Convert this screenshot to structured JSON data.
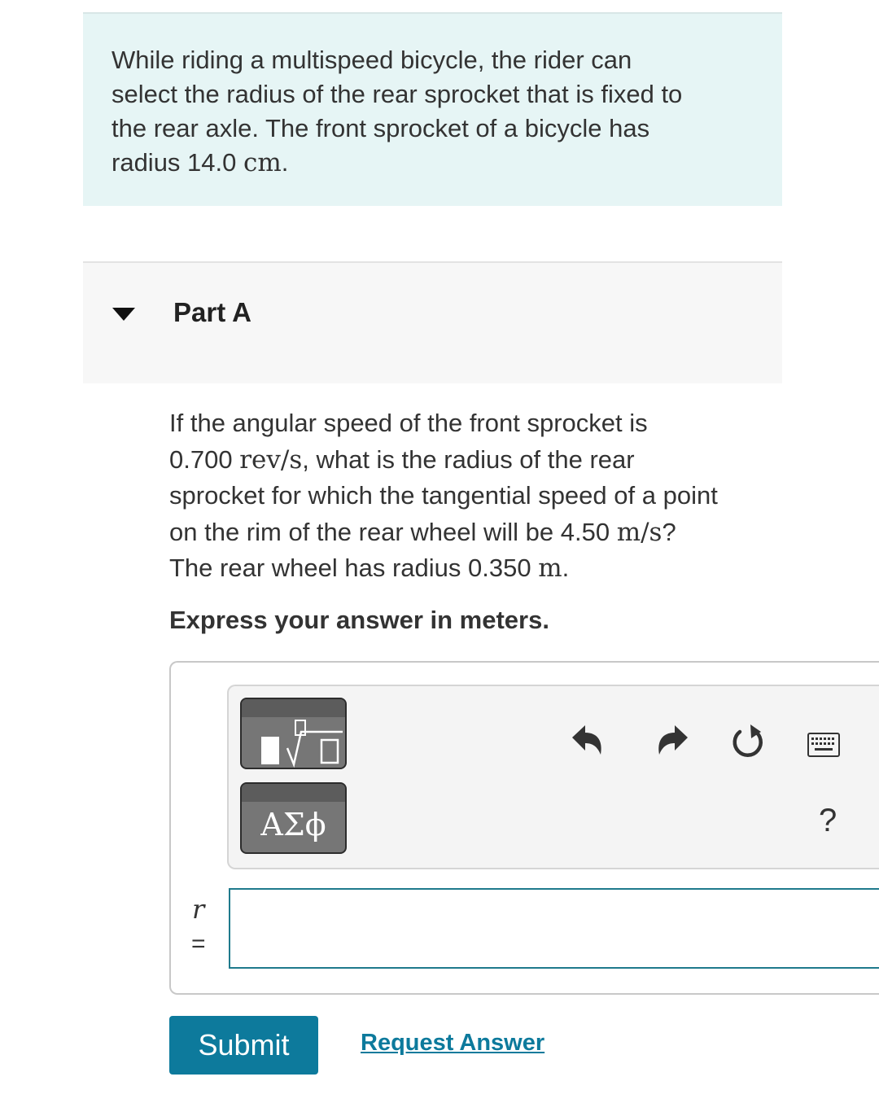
{
  "intro": {
    "line1": "While riding a multispeed bicycle, the rider can",
    "line2": "select the radius of the rear sprocket that is fixed to",
    "line3": "the rear axle. The front sprocket of a bicycle has",
    "line4_prefix": "radius 14.0",
    "line4_unit": "cm",
    "line4_suffix": "."
  },
  "part": {
    "title": "Part A",
    "caret_icon": "caret-down-icon"
  },
  "question": {
    "l1": "If the angular speed of the front sprocket is",
    "l2_value": "0.700",
    "l2_unit": "rev/s",
    "l2_rest": ", what is the radius of the rear",
    "l3": "sprocket for which the tangential speed of a point",
    "l4_text": "on the rim of the rear wheel will be 4.50",
    "l4_unit": "m/s",
    "l4_end": "?",
    "l5_text": "The rear wheel has radius 0.350",
    "l5_unit": "m",
    "l5_end": "."
  },
  "instruction": "Express your answer in meters.",
  "toolbar": {
    "templates_icon": "fraction-sqrt-templates-icon",
    "symbols_label": "ΑΣϕ",
    "undo_icon": "undo-icon",
    "redo_icon": "redo-icon",
    "reset_icon": "reset-icon",
    "keyboard_icon": "keyboard-icon",
    "help_label": "?"
  },
  "answer": {
    "variable": "r",
    "equals": "=",
    "value": ""
  },
  "buttons": {
    "submit": "Submit",
    "request_answer": "Request Answer"
  },
  "colors": {
    "intro_bg": "#e6f5f5",
    "accent": "#0d7a9c",
    "input_border": "#1f7a8c"
  }
}
